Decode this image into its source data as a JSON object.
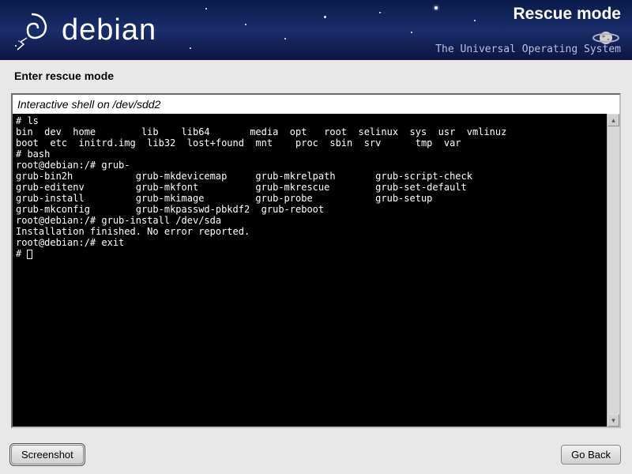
{
  "header": {
    "logo_text": "debian",
    "mode_title": "Rescue mode",
    "tagline": "The Universal Operating System"
  },
  "page_title": "Enter rescue mode",
  "terminal_label": "Interactive shell on /dev/sdd2",
  "terminal_lines": [
    "# ls",
    "bin  dev  home        lib    lib64       media  opt   root  selinux  sys  usr  vmlinuz",
    "boot  etc  initrd.img  lib32  lost+found  mnt    proc  sbin  srv      tmp  var",
    "# bash",
    "root@debian:/# grub-",
    "grub-bin2h           grub-mkdevicemap     grub-mkrelpath       grub-script-check",
    "grub-editenv         grub-mkfont          grub-mkrescue        grub-set-default",
    "grub-install         grub-mkimage         grub-probe           grub-setup",
    "grub-mkconfig        grub-mkpasswd-pbkdf2  grub-reboot",
    "root@debian:/# grub-install /dev/sda",
    "Installation finished. No error reported.",
    "root@debian:/# exit",
    "# "
  ],
  "buttons": {
    "screenshot": "Screenshot",
    "go_back": "Go Back"
  }
}
